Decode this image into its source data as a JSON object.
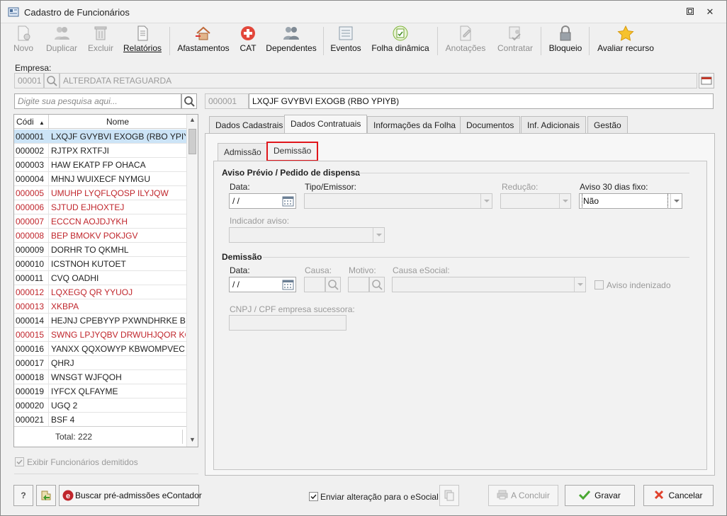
{
  "window": {
    "title": "Cadastro de Funcionários"
  },
  "toolbar": {
    "novo": "Novo",
    "duplicar": "Duplicar",
    "excluir": "Excluir",
    "relatorios": "Relatórios",
    "afastamentos": "Afastamentos",
    "cat": "CAT",
    "dependentes": "Dependentes",
    "eventos": "Eventos",
    "folha_dinamica": "Folha dinâmica",
    "anotacoes": "Anotações",
    "contratar": "Contratar",
    "bloqueio": "Bloqueio",
    "avaliar_recurso": "Avaliar recurso"
  },
  "empresa": {
    "label": "Empresa:",
    "code": "00001",
    "name": "ALTERDATA RETAGUARDA"
  },
  "search": {
    "placeholder": "Digite sua pesquisa aqui..."
  },
  "selected": {
    "code": "000001",
    "name": "LXQJF GVYBVI EXOGB (RBO YPIYB)"
  },
  "list": {
    "col_code": "Códi",
    "col_name": "Nome",
    "rows": [
      {
        "code": "000001",
        "name": "LXQJF GVYBVI EXOGB (RBO YPIYB)"
      },
      {
        "code": "000002",
        "name": "RJTPX RXTFJI"
      },
      {
        "code": "000003",
        "name": "HAW EKATP FP OHACA"
      },
      {
        "code": "000004",
        "name": "MHNJ WUIXECF NYMGU"
      },
      {
        "code": "000005",
        "name": "UMUHP LYQFLQOSP ILYJQW"
      },
      {
        "code": "000006",
        "name": "SJTUD EJHOXTEJ"
      },
      {
        "code": "000007",
        "name": "ECCCN  AOJDJYKH"
      },
      {
        "code": "000008",
        "name": "BEP BMOKV POKJGV"
      },
      {
        "code": "000009",
        "name": "DORHR TO QKMHL"
      },
      {
        "code": "000010",
        "name": "ICSTNOH KUTOET"
      },
      {
        "code": "000011",
        "name": "CVQ OADHI"
      },
      {
        "code": "000012",
        "name": "LQXEGQ QR YYUOJ"
      },
      {
        "code": "000013",
        "name": "XKBPA"
      },
      {
        "code": "000014",
        "name": "HEJNJ CPEBYYP PXWNDHRKE BTB J"
      },
      {
        "code": "000015",
        "name": "SWNG LPJYQBV DRWUHJQOR KQI Y"
      },
      {
        "code": "000016",
        "name": "YANXX QQXOWYP KBWOMPVEC A"
      },
      {
        "code": "000017",
        "name": "QHRJ"
      },
      {
        "code": "000018",
        "name": "WNSGT WJFQOH"
      },
      {
        "code": "000019",
        "name": "IYFCX QLFAYME"
      },
      {
        "code": "000020",
        "name": "UGQ 2"
      },
      {
        "code": "000021",
        "name": "BSF 4"
      }
    ],
    "total": "Total: 222"
  },
  "exibir_demitidos": "Exibir Funcionários demitidos",
  "tabs": {
    "dados_cadastrais": "Dados Cadastrais",
    "dados_contratuais": "Dados Contratuais",
    "informacoes_folha": "Informações da Folha",
    "documentos": "Documentos",
    "inf_adicionais": "Inf. Adicionais",
    "gestao": "Gestão"
  },
  "subtabs": {
    "admissao": "Admissão",
    "demissao": "Demissão"
  },
  "aviso": {
    "section": "Aviso Prévio / Pedido de dispensa",
    "data_label": "Data:",
    "data_value": " /  /",
    "tipo_label": "Tipo/Emissor:",
    "reducao_label": "Redução:",
    "aviso30_label": "Aviso 30 dias fixo:",
    "aviso30_value": "Não",
    "indicador_label": "Indicador aviso:"
  },
  "demissao": {
    "section": "Demissão",
    "data_label": "Data:",
    "data_value": " /  /",
    "causa_label": "Causa:",
    "motivo_label": "Motivo:",
    "causa_esocial_label": "Causa eSocial:",
    "aviso_indenizado": "Aviso indenizado",
    "cnpj_label": "CNPJ / CPF empresa sucessora:"
  },
  "bottom": {
    "help": "?",
    "buscar": "Buscar pré-admissões eContador",
    "enviar": "Enviar alteração para o eSocial",
    "concluir": "A Concluir",
    "gravar": "Gravar",
    "cancelar": "Cancelar"
  },
  "colors": {
    "red_row": "#c0262c",
    "selection": "#cce4f7",
    "highlight_border": "#e0161b"
  }
}
